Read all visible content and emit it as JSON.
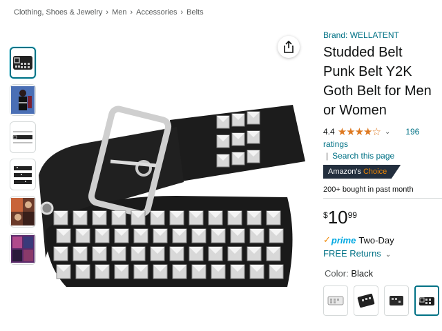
{
  "breadcrumb": [
    "Clothing, Shoes & Jewelry",
    "Men",
    "Accessories",
    "Belts"
  ],
  "breadcrumb_separator": "›",
  "product": {
    "brand": "Brand: WELLATENT",
    "title_lines": [
      "Studded Belt",
      "Punk Belt Y2K",
      "Goth Belt for Men",
      "or Women"
    ],
    "rating_value": "4.4",
    "stars": "★★★★☆",
    "rating_count": "196",
    "ratings_word": "ratings",
    "search_link": "Search this page",
    "badge_prefix": "Amazon's",
    "badge_suffix": "Choice",
    "bought": "200+ bought in past month",
    "price_currency": "$",
    "price_whole": "10",
    "price_fraction": "99",
    "prime_label": "prime",
    "prime_delivery": "Two-Day",
    "returns": "FREE Returns",
    "color_label": "Color:",
    "color_value": "Black"
  },
  "colors": {
    "link": "#007185",
    "star": "#de7921",
    "badge_bg": "#232f3e",
    "badge_accent": "#f08804",
    "prime_blue": "#00a8e1"
  },
  "icons": {
    "share": "share-icon",
    "chevron": "chevron-down-icon"
  }
}
